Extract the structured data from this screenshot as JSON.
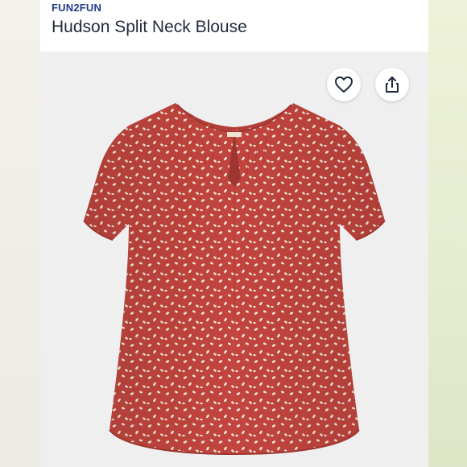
{
  "product": {
    "brand": "FUN2FUN",
    "title": "Hudson Split Neck Blouse"
  },
  "actions": {
    "favorite_icon": "heart-outline-icon",
    "share_icon": "share-icon"
  },
  "colors": {
    "brand_text": "#1f3a8a",
    "title_text": "#1f2a3a",
    "blouse_red": "#c2453e",
    "dot_color": "#f2e6d6"
  }
}
